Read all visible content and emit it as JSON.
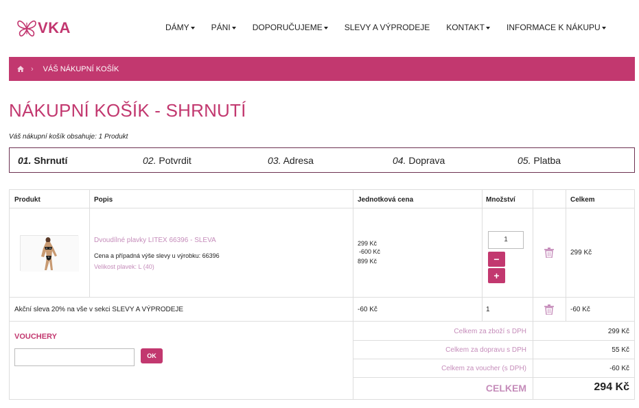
{
  "header": {
    "logo_text": "VKA",
    "nav": [
      {
        "label": "DÁMY",
        "has_caret": true
      },
      {
        "label": "PÁNI",
        "has_caret": true
      },
      {
        "label": "DOPORUČUJEME",
        "has_caret": true
      },
      {
        "label": "SLEVY A VÝPRODEJE",
        "has_caret": false
      },
      {
        "label": "KONTAKT",
        "has_caret": true
      },
      {
        "label": "INFORMACE K NÁKUPU",
        "has_caret": true
      }
    ]
  },
  "breadcrumb": {
    "home_icon": "home-icon",
    "current": "VÁŠ NÁKUPNÍ KOŠÍK"
  },
  "page_title": "NÁKUPNÍ KOŠÍK - SHRNUTÍ",
  "cart_count": "Váš nákupní košík obsahuje: 1 Produkt",
  "steps": [
    {
      "num": "01.",
      "label": "Shrnutí",
      "active": true
    },
    {
      "num": "02.",
      "label": "Potvrdit",
      "active": false
    },
    {
      "num": "03.",
      "label": "Adresa",
      "active": false
    },
    {
      "num": "04.",
      "label": "Doprava",
      "active": false
    },
    {
      "num": "05.",
      "label": "Platba",
      "active": false
    }
  ],
  "table": {
    "headers": {
      "product": "Produkt",
      "description": "Popis",
      "unit_price": "Jednotková cena",
      "quantity": "Množství",
      "total": "Celkem"
    },
    "item": {
      "name": "Dvoudílné plavky LITEX 66396 - SLEVA",
      "note": "Cena a případná výše slevy u výrobku: 66396",
      "variant": "Velikost plavek: L (40)",
      "price_now": "299 Kč",
      "discount": "-600 Kč",
      "price_orig": "899 Kč",
      "quantity": "1",
      "minus": "−",
      "plus": "+",
      "total": "299 Kč"
    },
    "discount_row": {
      "label": "Akční sleva 20% na vše v sekci SLEVY A VÝPRODEJE",
      "unit_price": "-60 Kč",
      "quantity": "1",
      "total": "-60 Kč"
    }
  },
  "vouchers": {
    "title": "VOUCHERY",
    "input_value": "",
    "ok_label": "OK"
  },
  "summary": [
    {
      "label": "Celkem za zboží s DPH",
      "value": "299 Kč"
    },
    {
      "label": "Celkem za dopravu s DPH",
      "value": "55 Kč"
    },
    {
      "label": "Celkem za voucher (s DPH)",
      "value": "-60 Kč"
    }
  ],
  "grand_total": {
    "label": "CELKEM",
    "value": "294 Kč"
  },
  "colors": {
    "brand": "#c2386f",
    "link": "#c58cba"
  }
}
